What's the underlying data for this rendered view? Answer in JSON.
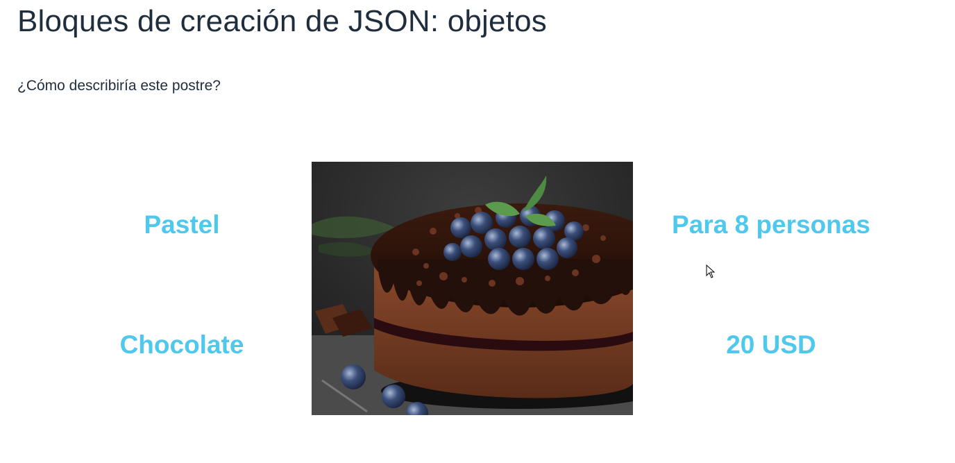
{
  "slide": {
    "title": "Bloques de creación de JSON: objetos",
    "question": "¿Cómo describiría este postre?"
  },
  "descriptors": {
    "top_left": "Pastel",
    "bottom_left": "Chocolate",
    "top_right": "Para 8 personas",
    "bottom_right": "20 USD"
  },
  "colors": {
    "title_text": "#1f2d3d",
    "accent": "#4fc8ee"
  },
  "image": {
    "subject": "chocolate-cake-with-blueberries"
  },
  "icons": {
    "pointer": "mouse-pointer-icon"
  }
}
